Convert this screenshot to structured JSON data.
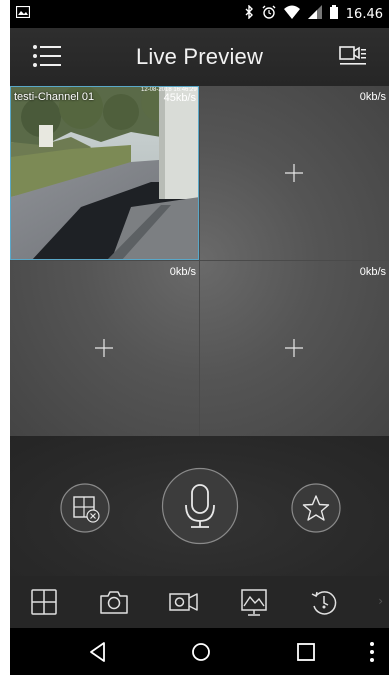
{
  "status_bar": {
    "time": "16.46",
    "icons": [
      "photo-icon",
      "bluetooth-icon",
      "alarm-icon",
      "wifi-icon",
      "signal-icon",
      "battery-icon"
    ]
  },
  "header": {
    "title": "Live Preview",
    "menu_icon": "hamburger-menu-icon",
    "right_icon": "camera-list-icon"
  },
  "grid": {
    "channels": [
      {
        "label": "testi-Channel 01",
        "rate": "45kb/s",
        "timestamp": "12-08-2018 16:46:29",
        "active": true
      },
      {
        "label": "",
        "rate": "0kb/s",
        "active": false
      },
      {
        "label": "",
        "rate": "0kb/s",
        "active": false
      },
      {
        "label": "",
        "rate": "0kb/s",
        "active": false
      }
    ]
  },
  "controls": {
    "left_icon": "close-split-icon",
    "center_icon": "microphone-icon",
    "right_icon": "star-icon"
  },
  "toolbar": {
    "items": [
      "layout-grid-icon",
      "camera-snapshot-icon",
      "video-record-icon",
      "playback-monitor-icon",
      "history-icon"
    ],
    "more": "›"
  },
  "navbar": {
    "items": [
      "back-icon",
      "home-icon",
      "recents-icon",
      "more-vert-icon"
    ]
  },
  "colors": {
    "accent": "#5aa8c8",
    "icon": "#e0e0e0"
  }
}
